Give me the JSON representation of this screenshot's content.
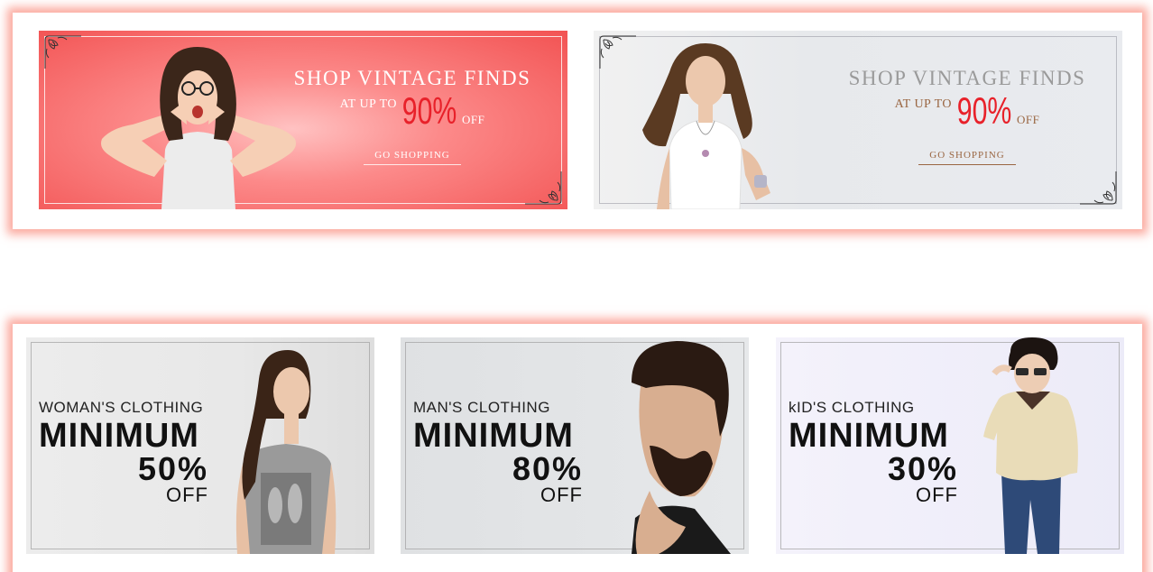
{
  "promo_top": {
    "banners": [
      {
        "title": "SHOP VINTAGE FINDS",
        "offer_prefix": "AT UP TO",
        "offer_value": "90%",
        "offer_suffix": "OFF",
        "cta": "GO SHOPPING",
        "background_color": "#f25252",
        "image": "woman-surprised-photo"
      },
      {
        "title": "SHOP VINTAGE FINDS",
        "offer_prefix": "AT UP TO",
        "offer_value": "90%",
        "offer_suffix": "OFF",
        "cta": "GO SHOPPING",
        "background_color": "#e9ebef",
        "image": "woman-necklace-photo"
      }
    ]
  },
  "promo_bottom": {
    "cards": [
      {
        "category": "WOMAN'S CLOTHING",
        "headline": "MINIMUM",
        "discount": "50%",
        "suffix": "OFF",
        "image": "woman-tshirt-photo"
      },
      {
        "category": "MAN'S CLOTHING",
        "headline": "MINIMUM",
        "discount": "80%",
        "suffix": "OFF",
        "image": "bearded-man-photo"
      },
      {
        "category": "kID'S CLOTHING",
        "headline": "MINIMUM",
        "discount": "30%",
        "suffix": "OFF",
        "image": "boy-sunglasses-photo"
      }
    ]
  },
  "colors": {
    "panel_glow": "#fa8c7d",
    "offer_red": "#e8212a",
    "cta_brown": "#9a6642"
  }
}
